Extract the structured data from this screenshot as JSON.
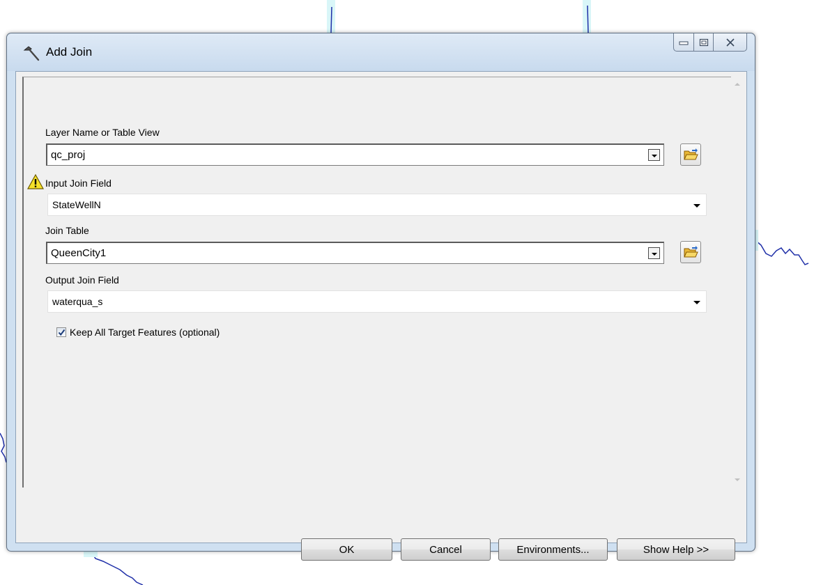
{
  "window": {
    "title": "Add Join",
    "icon": "hammer-icon"
  },
  "caption": {
    "minimize_icon": "minimize-icon",
    "maximize_icon": "maximize-icon",
    "close_icon": "close-icon"
  },
  "params": {
    "layer": {
      "label": "Layer Name or Table View",
      "value": "qc_proj"
    },
    "input_join_field": {
      "label": "Input Join Field",
      "value": "StateWellN",
      "warning_icon": "warning-icon"
    },
    "join_table": {
      "label": "Join Table",
      "value": "QueenCity1"
    },
    "output_join_field": {
      "label": "Output Join Field",
      "value": "waterqua_s"
    },
    "keep_all": {
      "label": "Keep All Target Features (optional)",
      "checked": true
    }
  },
  "buttons": {
    "ok": "OK",
    "cancel": "Cancel",
    "environments": "Environments...",
    "show_help": "Show Help >>"
  },
  "colors": {
    "map_line": "#1f2fa8",
    "map_highlight": "#c6f2f6",
    "window_frame": "#cfe0f1"
  }
}
